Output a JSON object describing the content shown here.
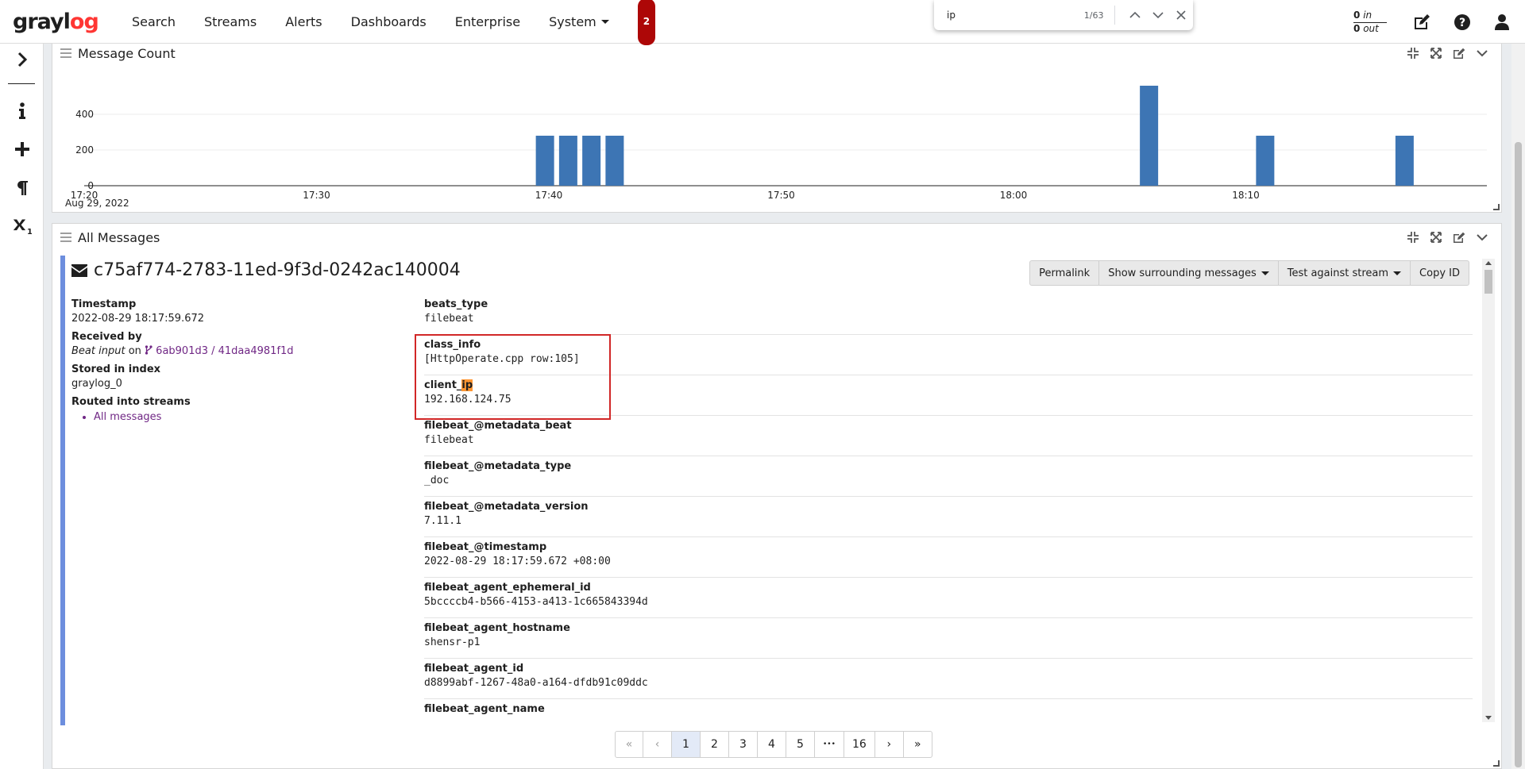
{
  "nav": {
    "logo_pre": "gray",
    "logo_o": "l",
    "logo_post": "og",
    "items": [
      "Search",
      "Streams",
      "Alerts",
      "Dashboards",
      "Enterprise",
      "System"
    ],
    "notification_count": "2",
    "throughput": {
      "in_value": "0",
      "in_label": "in",
      "out_value": "0",
      "out_label": "out"
    }
  },
  "findbar": {
    "query": "ip",
    "count": "1/63"
  },
  "sidebar": {
    "icons": [
      "chevron-right-icon",
      "info-icon",
      "plus-icon",
      "pilcrow-icon",
      "subscript-x-icon"
    ]
  },
  "message_count_widget": {
    "title": "Message Count"
  },
  "chart_data": {
    "type": "bar",
    "title": "Message Count",
    "x_ticks": [
      "17:20",
      "17:30",
      "17:40",
      "17:50",
      "18:00",
      "18:10"
    ],
    "x_sublabel": "Aug 29, 2022",
    "y_ticks": [
      0,
      200,
      400
    ],
    "ylim": [
      0,
      560
    ],
    "bars": [
      {
        "t": "17:39:50",
        "value": 280
      },
      {
        "t": "17:40:50",
        "value": 280
      },
      {
        "t": "17:41:50",
        "value": 280
      },
      {
        "t": "17:42:50",
        "value": 280
      },
      {
        "t": "18:05:50",
        "value": 560
      },
      {
        "t": "18:10:50",
        "value": 280
      },
      {
        "t": "18:16:50",
        "value": 280
      }
    ],
    "bar_color": "#3d75b4",
    "grid": true
  },
  "all_messages_widget": {
    "title": "All Messages"
  },
  "message": {
    "id": "c75af774-2783-11ed-9f3d-0242ac140004",
    "buttons": {
      "permalink": "Permalink",
      "surrounding": "Show surrounding messages",
      "test_stream": "Test against stream",
      "copy_id": "Copy ID"
    },
    "meta": {
      "timestamp_label": "Timestamp",
      "timestamp": "2022-08-29 18:17:59.672",
      "received_label": "Received by",
      "received_input": "Beat input",
      "received_on": " on ",
      "received_node": "6ab901d3 / 41daa4981f1d",
      "index_label": "Stored in index",
      "index": "graylog_0",
      "streams_label": "Routed into streams",
      "streams": [
        "All messages"
      ]
    },
    "fields": [
      {
        "name": "beats_type",
        "value": "filebeat"
      },
      {
        "name": "class_info",
        "value": "[HttpOperate.cpp row:105]"
      },
      {
        "name_pre": "client_",
        "name_hl": "ip",
        "value": "192.168.124.75"
      },
      {
        "name": "filebeat_@metadata_beat",
        "value": "filebeat"
      },
      {
        "name": "filebeat_@metadata_type",
        "value": "_doc"
      },
      {
        "name": "filebeat_@metadata_version",
        "value": "7.11.1"
      },
      {
        "name": "filebeat_@timestamp",
        "value": "2022-08-29 18:17:59.672 +08:00"
      },
      {
        "name": "filebeat_agent_ephemeral_id",
        "value": "5bccccb4-b566-4153-a413-1c665843394d"
      },
      {
        "name": "filebeat_agent_hostname",
        "value": "shensr-p1"
      },
      {
        "name": "filebeat_agent_id",
        "value": "d8899abf-1267-48a0-a164-dfdb91c09ddc"
      },
      {
        "name": "filebeat_agent_name",
        "value": ""
      }
    ]
  },
  "pagination": {
    "first": "«",
    "prev": "‹",
    "pages": [
      "1",
      "2",
      "3",
      "4",
      "5"
    ],
    "ellipsis": "•••",
    "last_page": "16",
    "next": "›",
    "last": "»",
    "current": "1"
  }
}
